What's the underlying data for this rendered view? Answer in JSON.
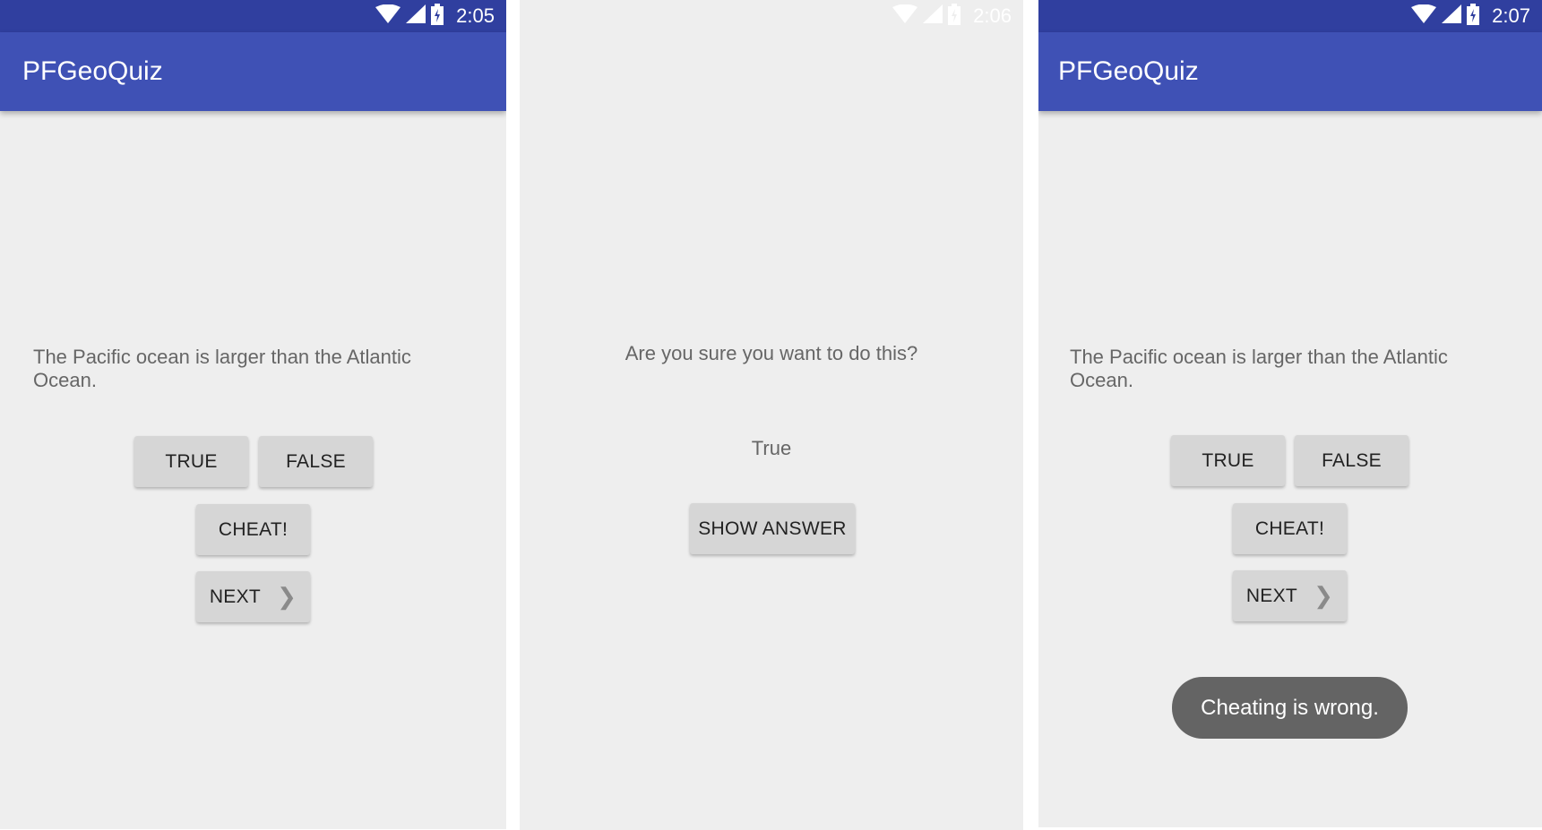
{
  "screens": [
    {
      "status_time": "2:05",
      "app_title": "PFGeoQuiz",
      "question": "The Pacific ocean is larger than the Atlantic Ocean.",
      "true_label": "TRUE",
      "false_label": "FALSE",
      "cheat_label": "CHEAT!",
      "next_label": "NEXT"
    },
    {
      "status_time": "2:06",
      "warning": "Are you sure you want to do this?",
      "answer": "True",
      "show_answer_label": "SHOW ANSWER"
    },
    {
      "status_time": "2:07",
      "app_title": "PFGeoQuiz",
      "question": "The Pacific ocean is larger than the Atlantic Ocean.",
      "true_label": "TRUE",
      "false_label": "FALSE",
      "cheat_label": "CHEAT!",
      "next_label": "NEXT",
      "toast": "Cheating is wrong."
    }
  ],
  "icons": [
    "wifi-icon",
    "cell-signal-icon",
    "battery-charging-icon",
    "chevron-right-icon"
  ],
  "colors": {
    "status_bar": "#303f9f",
    "app_bar": "#3f51b5",
    "background": "#eeeeee",
    "button": "#d6d6d6",
    "toast": "#646464"
  }
}
